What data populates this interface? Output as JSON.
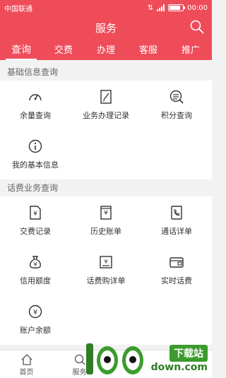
{
  "status": {
    "carrier": "中国联通",
    "time": "00:00"
  },
  "appbar": {
    "title": "服务"
  },
  "tabs": [
    "查询",
    "交费",
    "办理",
    "客服",
    "推广"
  ],
  "sections": [
    {
      "title": "基础信息查询",
      "items": [
        "余量查询",
        "业务办理记录",
        "积分查询",
        "我的基本信息"
      ]
    },
    {
      "title": "话费业务查询",
      "items": [
        "交费记录",
        "历史账单",
        "通话详单",
        "信用额度",
        "话费购详单",
        "实时话费",
        "账户余额"
      ]
    }
  ],
  "bottom_nav": [
    "首页",
    "服务"
  ],
  "watermark": {
    "logo_text": "100",
    "badge": "下载站",
    "url": "down.com"
  },
  "colors": {
    "brand": "#ef4c5a",
    "icon": "#333333"
  }
}
